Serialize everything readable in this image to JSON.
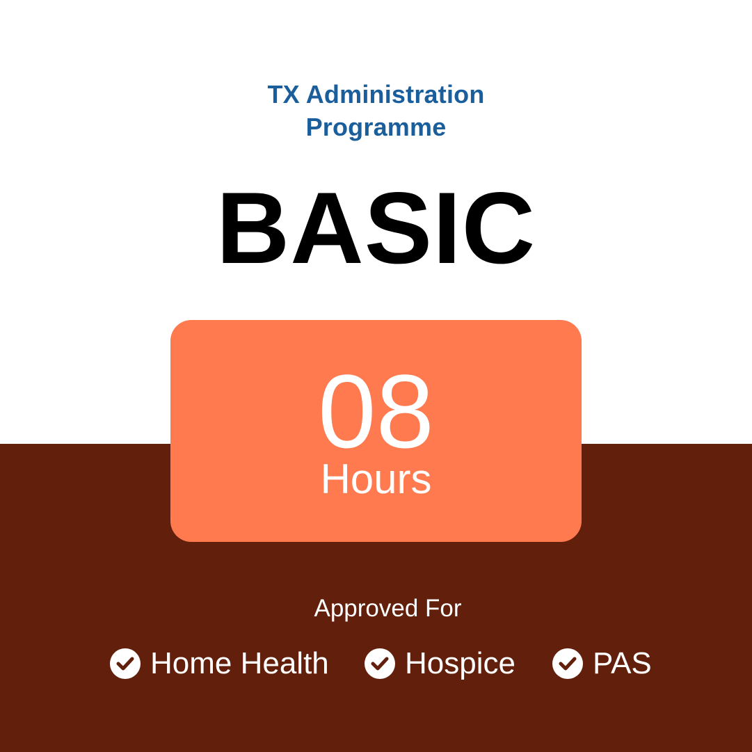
{
  "programme": {
    "line1": "TX Administration",
    "line2": "Programme"
  },
  "level": "BASIC",
  "duration": {
    "number": "08",
    "unit": "Hours"
  },
  "approval": {
    "label": "Approved For",
    "items": [
      {
        "label": "Home Health",
        "icon": "check-circle-icon"
      },
      {
        "label": "Hospice",
        "icon": "check-circle-icon"
      },
      {
        "label": "PAS",
        "icon": "check-circle-icon"
      }
    ]
  },
  "colors": {
    "title_blue": "#1b5e9c",
    "card_orange": "#ff7a4f",
    "background_brown": "#62200c"
  }
}
